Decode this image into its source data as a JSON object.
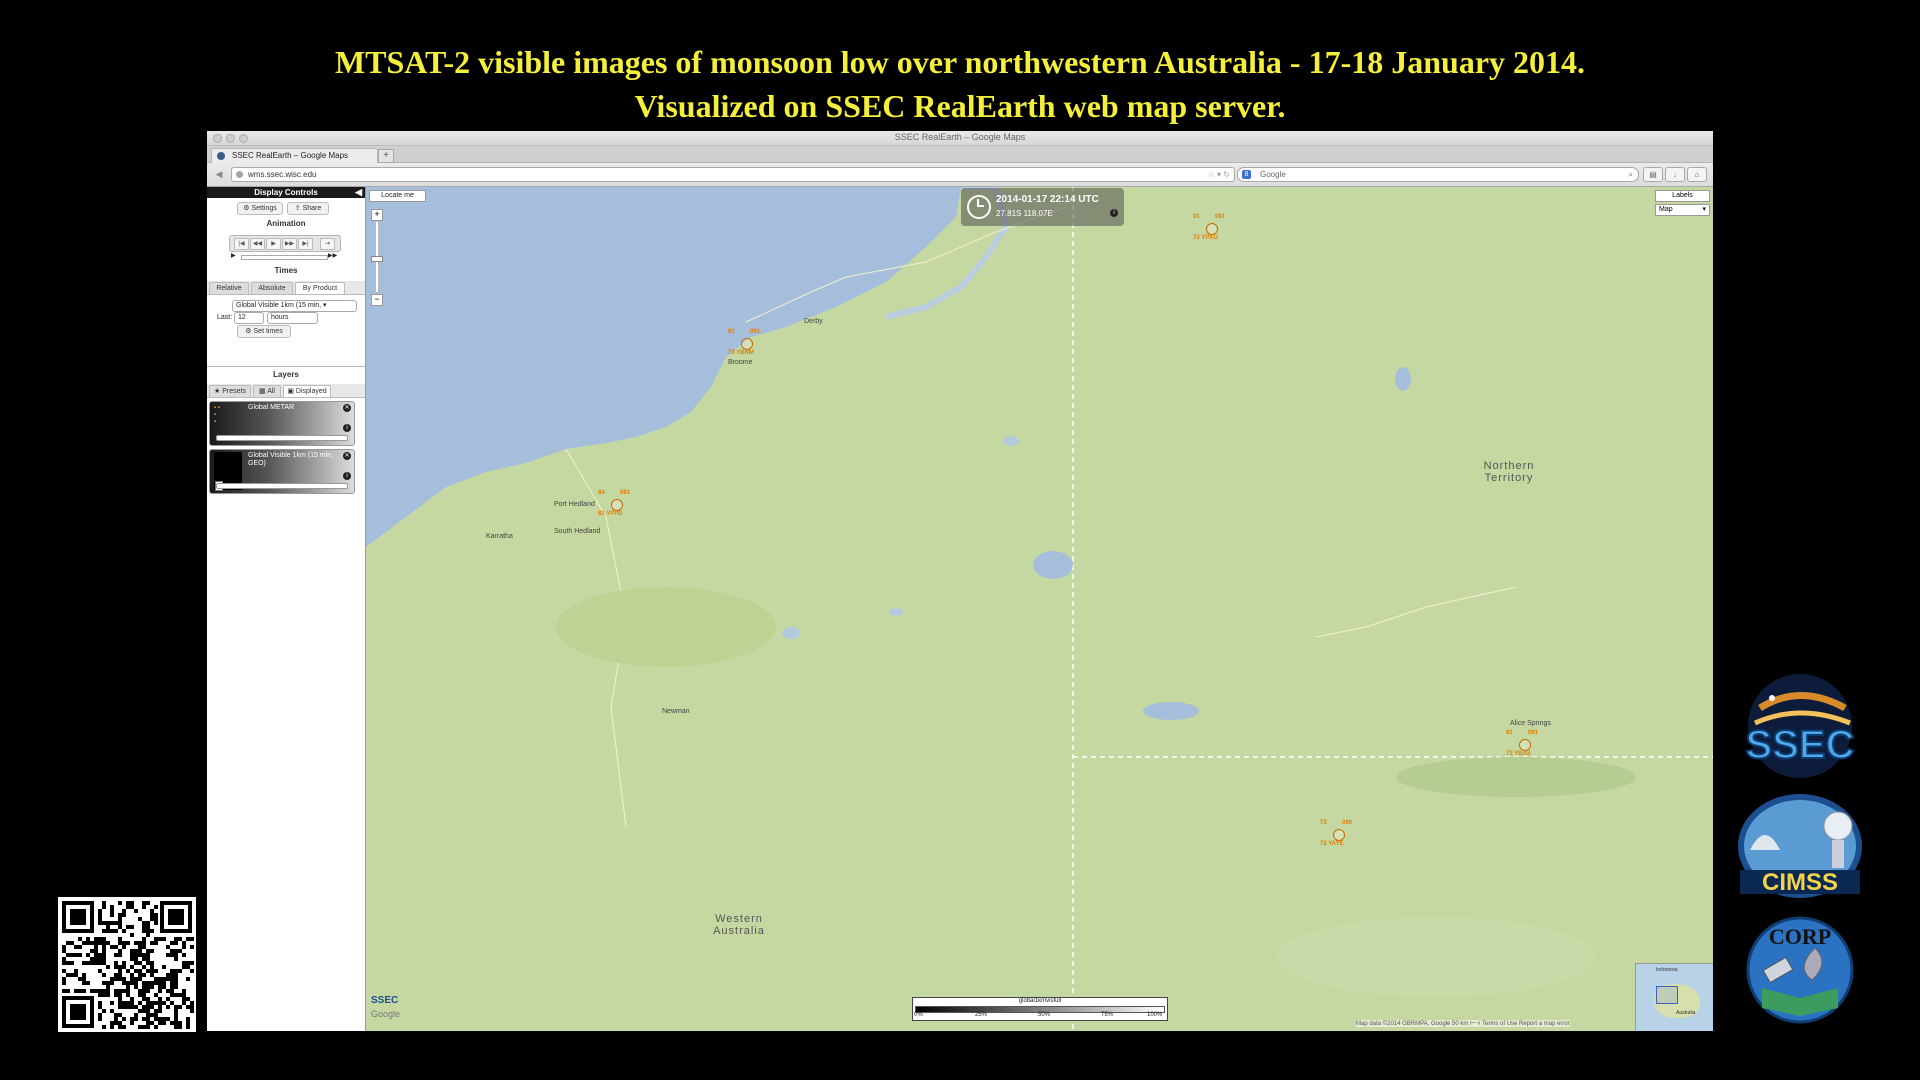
{
  "headline": {
    "line1": "MTSAT-2 visible images of monsoon low over northwestern Australia - 17-18 January 2014.",
    "line2": "Visualized on SSEC RealEarth web map server."
  },
  "browser": {
    "window_title": "SSEC RealEarth – Google Maps",
    "tab_label": "SSEC RealEarth – Google Maps",
    "url": "wms.ssec.wisc.edu",
    "search_placeholder": "Google",
    "search_engine_letter": "8"
  },
  "sidebar": {
    "header": "Display Controls",
    "settings_btn": "Settings",
    "share_btn": "Share",
    "animation_title": "Animation",
    "times_title": "Times",
    "time_tabs": [
      "Relative",
      "Absolute",
      "By Product"
    ],
    "product_select": "Global Visible 1km (15 min, ▾",
    "last_label": "Last:",
    "last_value": "12",
    "unit_select": "hours",
    "set_times_btn": "Set times",
    "layers_title": "Layers",
    "layer_tabs": [
      "Presets",
      "All",
      "Displayed"
    ],
    "layers": [
      {
        "name": "Global METAR"
      },
      {
        "name": "Global Visible 1km (15 min, GEO)"
      }
    ]
  },
  "map": {
    "locate_btn": "Locate me",
    "timestamp": "2014-01-17 22:14 UTC",
    "coordinates": "27.81S 118.07E",
    "labels_btn": "Labels",
    "map_type": "Map",
    "places": [
      "Derby",
      "Broome",
      "Port Hedland",
      "South Hedland",
      "Karratha",
      "Newman",
      "Alice Springs"
    ],
    "regions": [
      "Northern Territory",
      "Western Australia"
    ],
    "stations": [
      {
        "tl": "91",
        "tr": "091",
        "bl": "73 YPKU"
      },
      {
        "tl": "91",
        "tr": "091",
        "bl": "73 YBRM"
      },
      {
        "tl": "84",
        "tr": "091",
        "bl": "81 YPPD"
      },
      {
        "tl": "91",
        "tr": "091",
        "bl": "72 YBAS"
      },
      {
        "tl": "73",
        "tr": "090",
        "bl": "72 YAYE"
      }
    ],
    "colorbar": {
      "title": "global1kmvisfull",
      "ticks": [
        "0%",
        "25%",
        "50%",
        "75%",
        "100%"
      ]
    },
    "attribution": "Map data ©2014 GBRMPA, Google    50 km ⊢⊣    Terms of Use    Report a map error",
    "minimap_labels": [
      "Indonesia",
      "Australia"
    ],
    "watermark_ssec": "SSEC",
    "watermark_google": "Google"
  },
  "logos": [
    "SSEC",
    "CIMSS",
    "CORP"
  ],
  "colors": {
    "headline": "#f4ef3a",
    "ocean": "#a5bedb",
    "land": "#c6d8a2",
    "station_orange": "#e08000"
  }
}
